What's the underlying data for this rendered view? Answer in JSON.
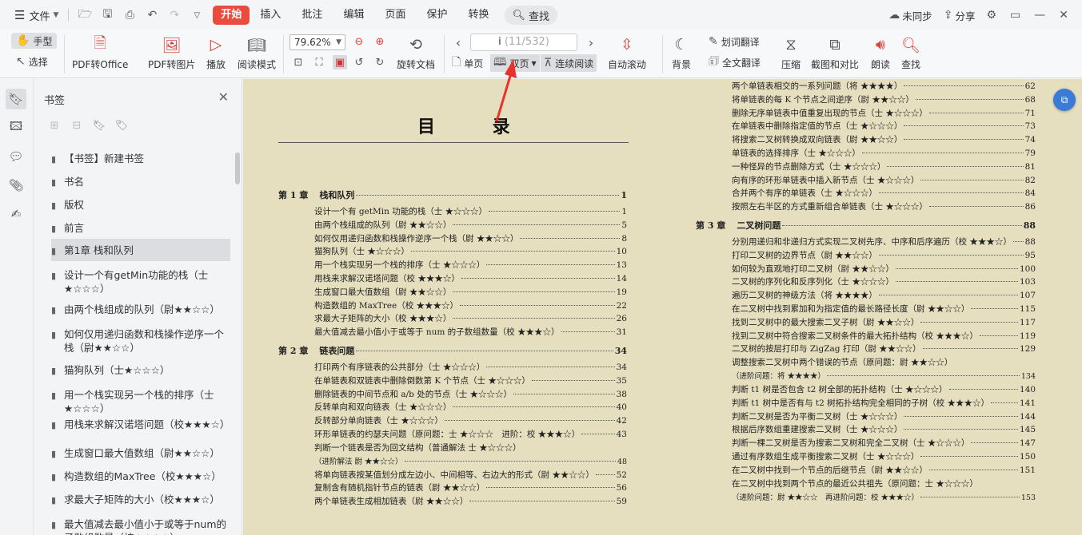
{
  "menubar": {
    "file": "文件",
    "tabs": [
      "开始",
      "插入",
      "批注",
      "编辑",
      "页面",
      "保护",
      "转换"
    ],
    "search": "查找",
    "sync": "未同步",
    "share": "分享"
  },
  "ribbon": {
    "hand": "手型",
    "select": "选择",
    "pdf_office": "PDF转Office",
    "pdf_image": "PDF转图片",
    "play": "播放",
    "read_mode": "阅读模式",
    "zoom": "79.62%",
    "rotate": "旋转文档",
    "page_current": "i",
    "page_total": "(11/532)",
    "single": "单页",
    "double": "双页",
    "continuous": "连续阅读",
    "autoscroll": "自动滚动",
    "background": "背景",
    "word_translate": "划词翻译",
    "full_translate": "全文翻译",
    "compress": "压缩",
    "compare": "截图和对比",
    "read_aloud": "朗读",
    "find": "查找"
  },
  "panel": {
    "title": "书签",
    "bookmarks": [
      "【书签】新建书签",
      "书名",
      "版权",
      "前言",
      "第1章 栈和队列",
      "设计一个有getMin功能的栈（士★☆☆☆）",
      "由两个栈组成的队列（尉★★☆☆）",
      "如何仅用递归函数和栈操作逆序一个栈（尉★★☆☆）",
      "猫狗队列（士★☆☆☆）",
      "用一个栈实现另一个栈的排序（士★☆☆☆）",
      "用栈来求解汉诺塔问题（校★★★☆）",
      "生成窗口最大值数组（尉★★☆☆）",
      "构造数组的MaxTree（校★★★☆）",
      "求最大子矩阵的大小（校★★★☆）",
      "最大值减去最小值小于或等于num的子数组数量（校★★★☆）"
    ]
  },
  "doc": {
    "title": "目 录",
    "left": [
      {
        "type": "ch",
        "num": "第 1 章",
        "text": "栈和队列",
        "page": "1"
      },
      {
        "text": "设计一个有 getMin 功能的栈（士 ★☆☆☆）",
        "page": "1"
      },
      {
        "text": "由两个栈组成的队列（尉 ★★☆☆）",
        "page": "5"
      },
      {
        "text": "如何仅用递归函数和栈操作逆序一个栈（尉 ★★☆☆）",
        "page": "8"
      },
      {
        "text": "猫狗队列（士 ★☆☆☆）",
        "page": "10"
      },
      {
        "text": "用一个栈实现另一个栈的排序（士 ★☆☆☆）",
        "page": "13"
      },
      {
        "text": "用栈来求解汉诺塔问题（校 ★★★☆）",
        "page": "14"
      },
      {
        "text": "生成窗口最大值数组（尉 ★★☆☆）",
        "page": "19"
      },
      {
        "text": "构造数组的 MaxTree（校 ★★★☆）",
        "page": "22"
      },
      {
        "text": "求最大子矩阵的大小（校 ★★★☆）",
        "page": "26"
      },
      {
        "text": "最大值减去最小值小于或等于 num 的子数组数量（校 ★★★☆）",
        "page": "31"
      },
      {
        "type": "ch",
        "num": "第 2 章",
        "text": "链表问题",
        "page": "34"
      },
      {
        "text": "打印两个有序链表的公共部分（士 ★☆☆☆）",
        "page": "34"
      },
      {
        "text": "在单链表和双链表中删除倒数第 K 个节点（士 ★☆☆☆）",
        "page": "35"
      },
      {
        "text": "删除链表的中间节点和 a/b 处的节点（士 ★☆☆☆）",
        "page": "38"
      },
      {
        "text": "反转单向和双向链表（士 ★☆☆☆）",
        "page": "40"
      },
      {
        "text": "反转部分单向链表（士 ★☆☆☆）",
        "page": "42"
      },
      {
        "text": "环形单链表的约瑟夫问题（原问题：士 ★☆☆☆　进阶：校 ★★★☆）",
        "page": "43"
      },
      {
        "type": "nl",
        "text": "判断一个链表是否为回文结构（普通解法 士 ★☆☆☆）"
      },
      {
        "text": "（进阶解法 尉 ★★☆☆）",
        "page": "48"
      },
      {
        "text": "将单向链表按某值划分成左边小、中间相等、右边大的形式（尉 ★★☆☆）",
        "page": "52"
      },
      {
        "text": "复制含有随机指针节点的链表（尉 ★★☆☆）",
        "page": "56"
      },
      {
        "text": "两个单链表生成相加链表（尉 ★★☆☆）",
        "page": "59"
      }
    ],
    "right": [
      {
        "text": "两个单链表相交的一系列问题（将 ★★★★）",
        "page": "62"
      },
      {
        "text": "将单链表的每 K 个节点之间逆序（尉 ★★☆☆）",
        "page": "68"
      },
      {
        "text": "删除无序单链表中值重复出现的节点（士 ★☆☆☆）",
        "page": "71"
      },
      {
        "text": "在单链表中删除指定值的节点（士 ★☆☆☆）",
        "page": "73"
      },
      {
        "text": "将搜索二叉树转换成双向链表（尉 ★★☆☆）",
        "page": "74"
      },
      {
        "text": "单链表的选择排序（士 ★☆☆☆）",
        "page": "79"
      },
      {
        "text": "一种怪异的节点删除方式（士 ★☆☆☆）",
        "page": "81"
      },
      {
        "text": "向有序的环形单链表中插入新节点（士 ★☆☆☆）",
        "page": "82"
      },
      {
        "text": "合并两个有序的单链表（士 ★☆☆☆）",
        "page": "84"
      },
      {
        "text": "按照左右半区的方式重新组合单链表（士 ★☆☆☆）",
        "page": "86"
      },
      {
        "type": "ch",
        "num": "第 3 章",
        "text": "二叉树问题",
        "page": "88"
      },
      {
        "text": "分别用递归和非递归方式实现二叉树先序、中序和后序遍历（校 ★★★☆）",
        "page": "88"
      },
      {
        "text": "打印二叉树的边界节点（尉 ★★☆☆）",
        "page": "95"
      },
      {
        "text": "如何较为直观地打印二叉树（尉 ★★☆☆）",
        "page": "100"
      },
      {
        "text": "二叉树的序列化和反序列化（士 ★☆☆☆）",
        "page": "103"
      },
      {
        "text": "遍历二叉树的神级方法（将 ★★★★）",
        "page": "107"
      },
      {
        "text": "在二叉树中找到累加和为指定值的最长路径长度（尉 ★★☆☆）",
        "page": "115"
      },
      {
        "text": "找到二叉树中的最大搜索二叉子树（尉 ★★☆☆）",
        "page": "117"
      },
      {
        "text": "找到二叉树中符合搜索二叉树条件的最大拓扑结构（校 ★★★☆）",
        "page": "119"
      },
      {
        "text": "二叉树的按层打印与 ZigZag 打印（尉 ★★☆☆）",
        "page": "129"
      },
      {
        "type": "nl",
        "text": "调整搜索二叉树中两个错误的节点（原问题：尉 ★★☆☆）"
      },
      {
        "text": "（进阶问题：将 ★★★★）",
        "page": "134"
      },
      {
        "text": "判断 t1 树是否包含 t2 树全部的拓扑结构（士 ★☆☆☆）",
        "page": "140"
      },
      {
        "text": "判断 t1 树中是否有与 t2 树拓扑结构完全相同的子树（校 ★★★☆）",
        "page": "141"
      },
      {
        "text": "判断二叉树是否为平衡二叉树（士 ★☆☆☆）",
        "page": "144"
      },
      {
        "text": "根据后序数组重建搜索二叉树（士 ★☆☆☆）",
        "page": "145"
      },
      {
        "text": "判断一棵二叉树是否为搜索二叉树和完全二叉树（士 ★☆☆☆）",
        "page": "147"
      },
      {
        "text": "通过有序数组生成平衡搜索二叉树（士 ★☆☆☆）",
        "page": "150"
      },
      {
        "text": "在二叉树中找到一个节点的后继节点（尉 ★★☆☆）",
        "page": "151"
      },
      {
        "type": "nl",
        "text": "在二叉树中找到两个节点的最近公共祖先（原问题：士 ★☆☆☆）"
      },
      {
        "text": "（进阶问题：尉 ★★☆☆　再进阶问题：校 ★★★☆）",
        "page": "153"
      }
    ]
  },
  "colors": {
    "accent": "#e94b3c",
    "page": "#e6dfbf",
    "annotation": "#e8322a"
  }
}
